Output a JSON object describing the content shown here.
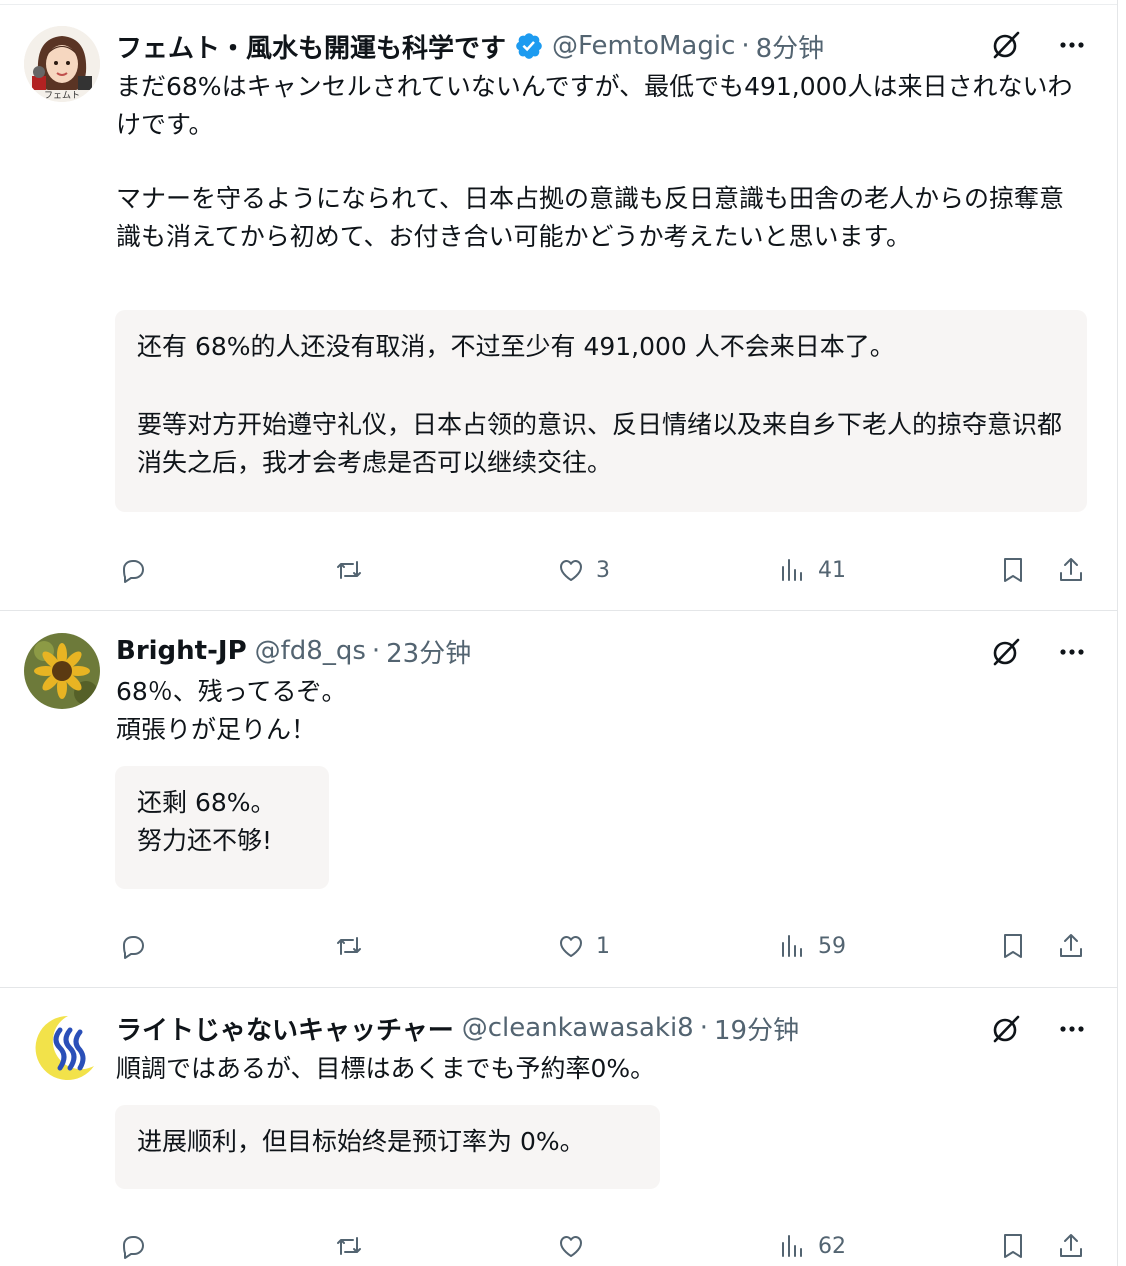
{
  "tweets": [
    {
      "name": "フェムト・風水も開運も科学です",
      "verified": true,
      "handle": "@FemtoMagic",
      "time": "8分钟",
      "avatar_caption": "フェムト",
      "body": [
        "まだ68%はキャンセルされていないんですが、最低でも491,000人は来日されないわけです。",
        "マナーを守るようになられて、日本占拠の意識も反日意識も田舎の老人からの掠奪意識も消えてから初めて、お付き合い可能かどうか考えたいと思います。"
      ],
      "translation": [
        "还有 68%的人还没有取消，不过至少有 491,000 人不会来日本了。",
        "要等对方开始遵守礼仪，日本占领的意识、反日情绪以及来自乡下老人的掠夺意识都消失之后，我才会考虑是否可以继续交往。"
      ],
      "likes": "3",
      "views": "41"
    },
    {
      "name": "Bright-JP",
      "verified": false,
      "handle": "@fd8_qs",
      "time": "23分钟",
      "body": [
        "68％、残ってるぞ。",
        "頑張りが足りん！"
      ],
      "translation": [
        "还剩 68%。",
        "努力还不够!"
      ],
      "likes": "1",
      "views": "59"
    },
    {
      "name": "ライトじゃないキャッチャー",
      "verified": false,
      "handle": "@cleankawasaki8",
      "time": "19分钟",
      "body": [
        "順調ではあるが、目標はあくまでも予約率0%。"
      ],
      "translation": [
        "进展顺利，但目标始终是预订率为 0%。"
      ],
      "likes": "",
      "views": "62"
    }
  ],
  "separator": "·",
  "colors": {
    "text": "#0f1419",
    "secondary": "#536471",
    "verified": "#1d9bf0",
    "translation_bg": "#f7f5f4",
    "divider": "#e4e6e8"
  },
  "icons": [
    "grok-icon",
    "more-icon",
    "reply-icon",
    "retweet-icon",
    "like-icon",
    "views-icon",
    "bookmark-icon",
    "share-icon",
    "verified-badge-icon"
  ]
}
